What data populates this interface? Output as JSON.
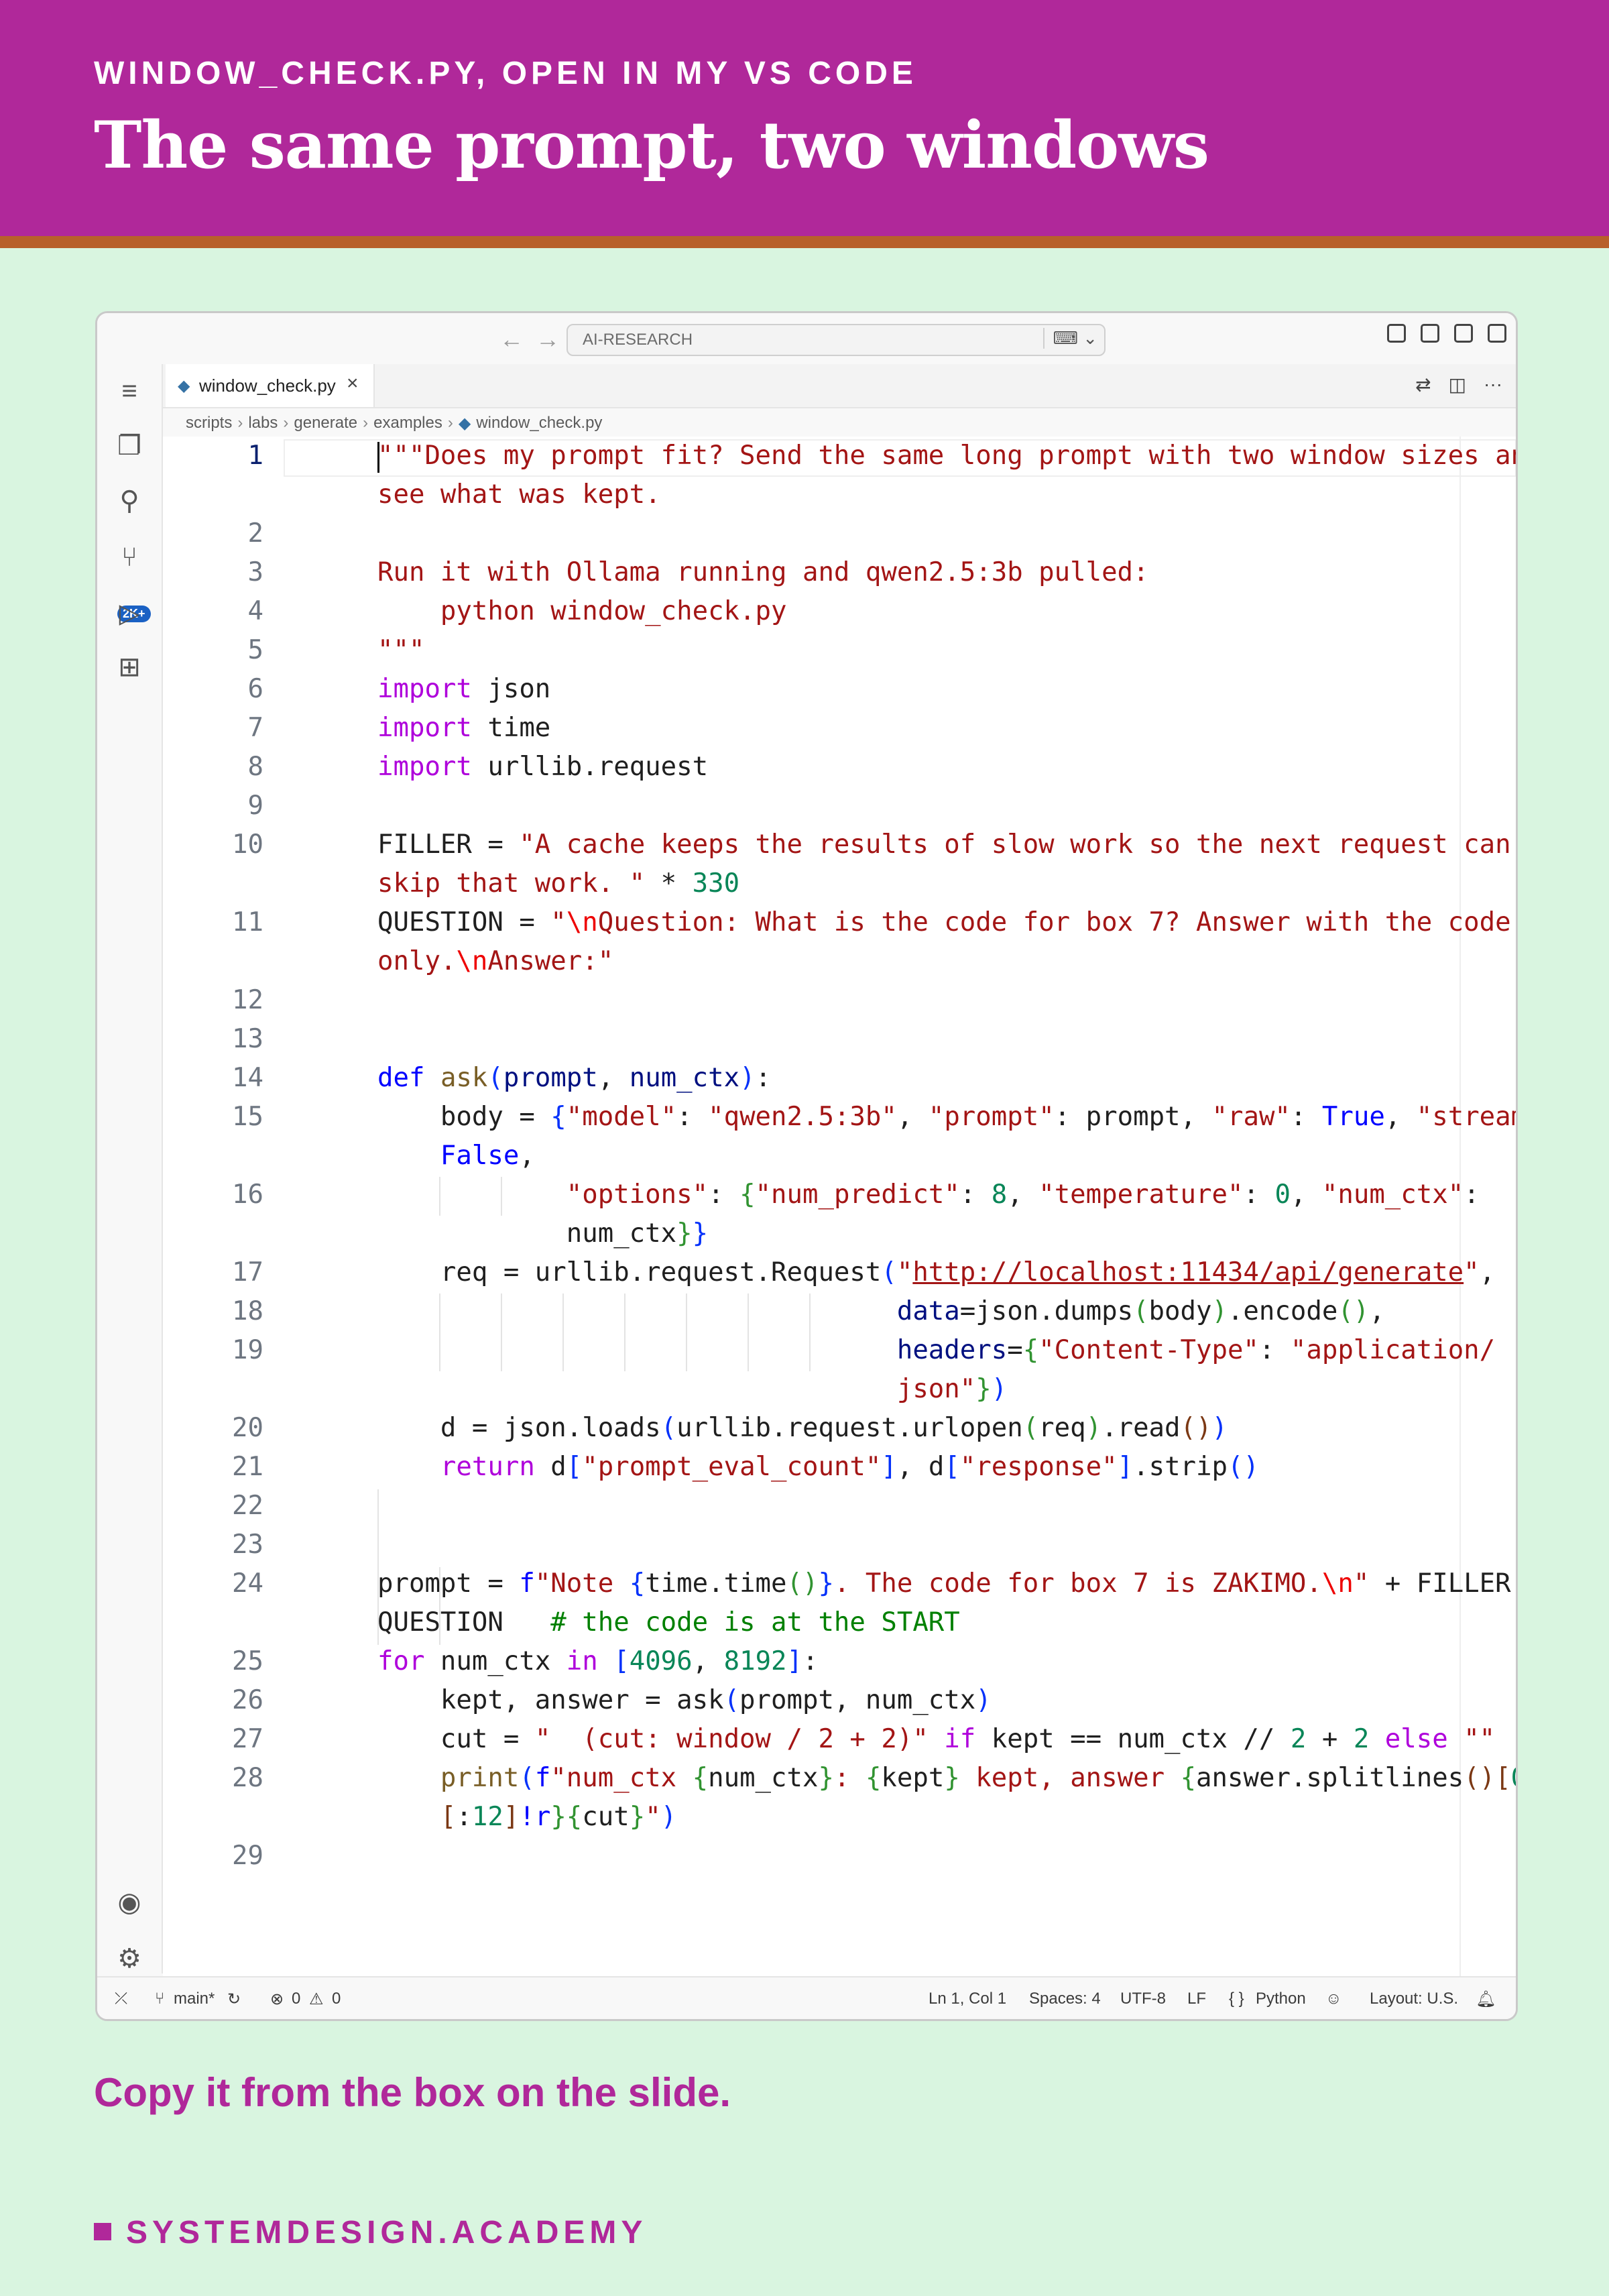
{
  "header": {
    "eyebrow": "WINDOW_CHECK.PY, OPEN IN MY VS CODE",
    "title": "The same prompt, two windows"
  },
  "window": {
    "command_center": "AI-RESEARCH",
    "tab_label": "window_check.py",
    "breadcrumb": [
      "scripts",
      "labs",
      "generate",
      "examples",
      "window_check.py"
    ],
    "activity_badge": "2K+"
  },
  "code": {
    "line_numbers": [
      "1",
      "",
      "2",
      "3",
      "4",
      "5",
      "6",
      "7",
      "8",
      "9",
      "10",
      "",
      "11",
      "",
      "12",
      "13",
      "14",
      "15",
      "",
      "16",
      "",
      "17",
      "18",
      "19",
      "",
      "20",
      "21",
      "22",
      "23",
      "24",
      "",
      "25",
      "26",
      "27",
      "28",
      "",
      "29"
    ]
  },
  "statusbar": {
    "branch": "main*",
    "errors": "0",
    "warnings": "0",
    "position": "Ln 1, Col 1",
    "spaces": "Spaces: 4",
    "encoding": "UTF-8",
    "eol": "LF",
    "language": "Python",
    "layout": "Layout: U.S."
  },
  "footer": {
    "caption": "Copy it from the box on the slide.",
    "brand": "SYSTEMDESIGN.ACADEMY"
  },
  "colors": {
    "banner": "#b0289a",
    "stripe": "#b8602a",
    "background": "#d9f5e0",
    "string": "#a31515",
    "keyword": "#af00db",
    "number": "#098658",
    "comment": "#008000"
  }
}
